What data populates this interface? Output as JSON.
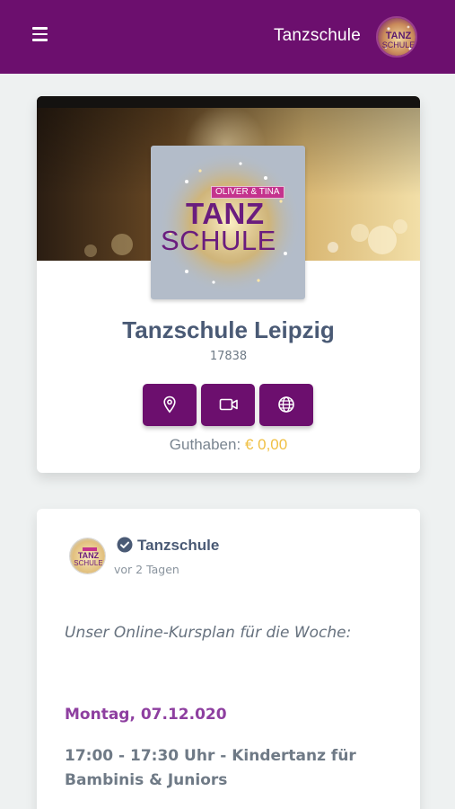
{
  "header": {
    "title": "Tanzschule",
    "logo_text_small": "TANZ SCHULE"
  },
  "school": {
    "logo_tag": "OLIVER & TINA",
    "logo_word1": "TANZ",
    "logo_word2": "SCHULE",
    "name": "Tanzschule Leipzig",
    "zip": "17838",
    "actions": [
      {
        "name": "location",
        "icon": "map-pin-icon"
      },
      {
        "name": "video",
        "icon": "video-camera-icon"
      },
      {
        "name": "website",
        "icon": "globe-icon"
      }
    ],
    "credit_label": "Guthaben:",
    "credit_value": "€ 0,00"
  },
  "post": {
    "author": "Tanzschule",
    "time": "vor 2 Tagen",
    "intro": "Unser Online-Kursplan für die Woche:",
    "day": "Montag, 07.12.020",
    "slot": "17:00 - 17:30 Uhr - Kindertanz für Bambinis & Juniors"
  },
  "colors": {
    "brand": "#6c0f6e",
    "credit": "#f0c044",
    "day_heading": "#8e3fa0"
  }
}
